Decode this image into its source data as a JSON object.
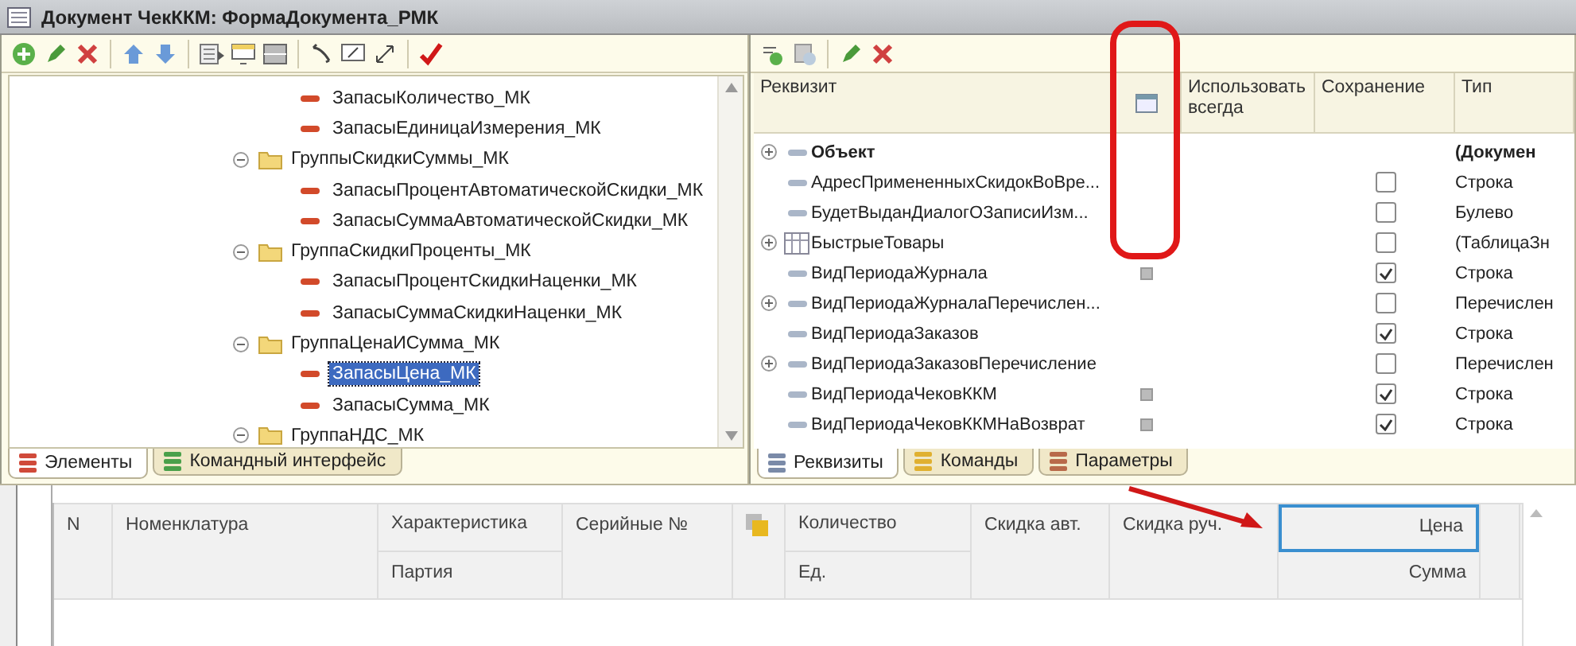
{
  "window": {
    "title": "Документ ЧекККМ: ФормаДокумента_РМК"
  },
  "elements_tree": {
    "nodes": [
      {
        "kind": "field",
        "label": "ЗапасыКоличество_МК",
        "selected": false
      },
      {
        "kind": "field",
        "label": "ЗапасыЕдиницаИзмерения_МК",
        "selected": false
      },
      {
        "kind": "group",
        "label": "ГруппыСкидкиСуммы_МК",
        "expanded": true,
        "children": [
          {
            "kind": "field",
            "label": "ЗапасыПроцентАвтоматическойСкидки_МК",
            "selected": false
          },
          {
            "kind": "field",
            "label": "ЗапасыСуммаАвтоматическойСкидки_МК",
            "selected": false
          }
        ]
      },
      {
        "kind": "group",
        "label": "ГруппаСкидкиПроценты_МК",
        "expanded": true,
        "children": [
          {
            "kind": "field",
            "label": "ЗапасыПроцентСкидкиНаценки_МК",
            "selected": false
          },
          {
            "kind": "field",
            "label": "ЗапасыСуммаСкидкиНаценки_МК",
            "selected": false
          }
        ]
      },
      {
        "kind": "group",
        "label": "ГруппаЦенаИСумма_МК",
        "expanded": true,
        "children": [
          {
            "kind": "field",
            "label": "ЗапасыЦена_МК",
            "selected": true
          },
          {
            "kind": "field",
            "label": "ЗапасыСумма_МК",
            "selected": false
          }
        ]
      },
      {
        "kind": "group",
        "label": "ГруппаНДС_МК",
        "expanded": true
      }
    ]
  },
  "left_tabs": [
    {
      "label": "Элементы",
      "selected": true
    },
    {
      "label": "Командный интерфейс",
      "selected": false
    }
  ],
  "attributes_table": {
    "columns": {
      "name": "Реквизит",
      "use_always": "Использовать всегда",
      "saving": "Сохранение",
      "type": "Тип"
    },
    "icon_column_marked": true,
    "rows": [
      {
        "kind": "object",
        "name": "Объект",
        "expandable": true,
        "marker": false,
        "type": "(Докумен"
      },
      {
        "kind": "field",
        "name": "АдресПримененныхСкидокВоВре...",
        "expandable": false,
        "marker": false,
        "saved": false,
        "type": "Строка"
      },
      {
        "kind": "field",
        "name": "БудетВыданДиалогОЗаписиИзм...",
        "expandable": false,
        "marker": false,
        "saved": false,
        "type": "Булево"
      },
      {
        "kind": "table",
        "name": "БыстрыеТовары",
        "expandable": true,
        "marker": false,
        "saved": false,
        "type": "(ТаблицаЗн"
      },
      {
        "kind": "field",
        "name": "ВидПериодаЖурнала",
        "expandable": false,
        "marker": true,
        "saved": true,
        "type": "Строка"
      },
      {
        "kind": "field",
        "name": "ВидПериодаЖурналаПеречислен...",
        "expandable": true,
        "marker": false,
        "saved": false,
        "type": "Перечислен"
      },
      {
        "kind": "field",
        "name": "ВидПериодаЗаказов",
        "expandable": false,
        "marker": false,
        "saved": true,
        "type": "Строка"
      },
      {
        "kind": "field",
        "name": "ВидПериодаЗаказовПеречисление",
        "expandable": true,
        "marker": false,
        "saved": false,
        "type": "Перечислен"
      },
      {
        "kind": "field",
        "name": "ВидПериодаЧековККМ",
        "expandable": false,
        "marker": true,
        "saved": true,
        "type": "Строка"
      },
      {
        "kind": "field",
        "name": "ВидПериодаЧековККМНаВозврат",
        "expandable": false,
        "marker": true,
        "saved": true,
        "type": "Строка"
      }
    ]
  },
  "right_tabs": [
    {
      "label": "Реквизиты",
      "selected": true
    },
    {
      "label": "Команды",
      "selected": false
    },
    {
      "label": "Параметры",
      "selected": false
    }
  ],
  "preview_grid": {
    "columns": [
      {
        "kind": "text",
        "top": "N"
      },
      {
        "kind": "text",
        "top": "Номенклатура"
      },
      {
        "kind": "split",
        "top": "Характеристика",
        "bottom": "Партия"
      },
      {
        "kind": "text",
        "top": "Серийные №"
      },
      {
        "kind": "icon"
      },
      {
        "kind": "split",
        "top": "Количество",
        "bottom": "Ед."
      },
      {
        "kind": "text",
        "top": "Скидка авт."
      },
      {
        "kind": "text",
        "top": "Скидка руч."
      },
      {
        "kind": "amount",
        "top": "Цена",
        "bottom": "Сумма",
        "highlighted": true
      },
      {
        "kind": "blank"
      }
    ]
  }
}
